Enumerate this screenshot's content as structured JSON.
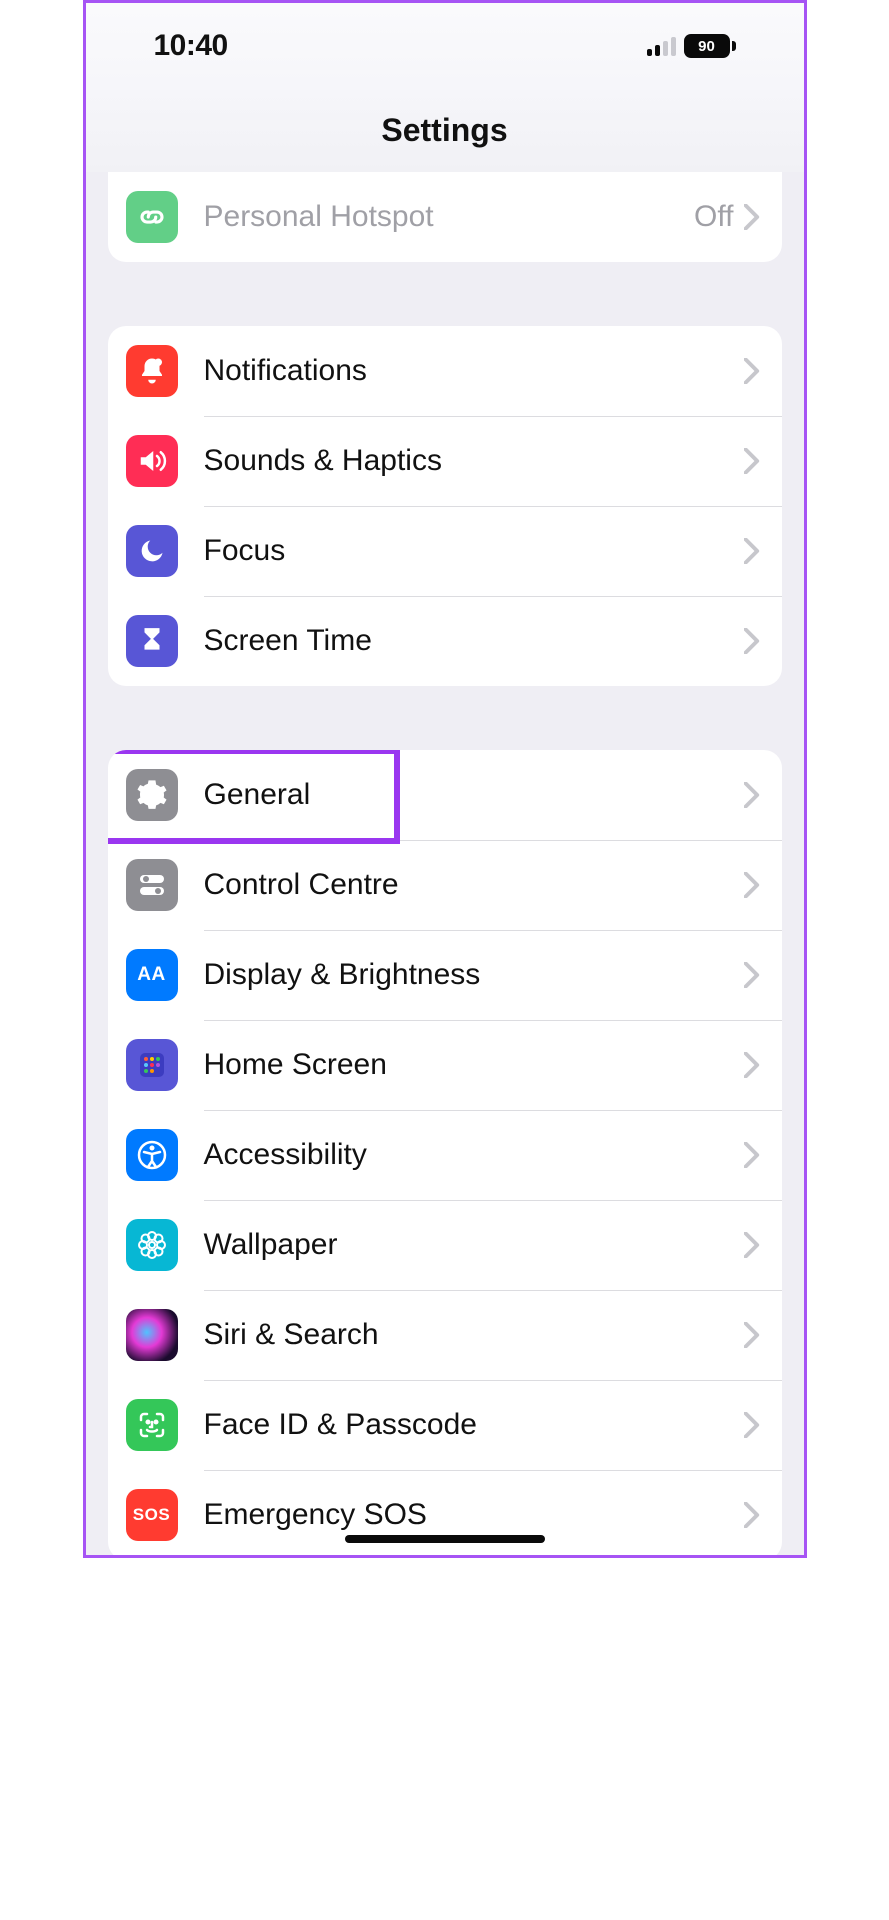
{
  "status": {
    "time": "10:40",
    "battery_pct": "90",
    "signal_active_bars": 2,
    "signal_total_bars": 4
  },
  "nav": {
    "title": "Settings"
  },
  "group0": {
    "items": [
      {
        "label": "Personal Hotspot",
        "detail": "Off",
        "icon_name": "link-icon",
        "icon_bg": "bg-green-hotspot",
        "disabled": true
      }
    ]
  },
  "group1": {
    "items": [
      {
        "label": "Notifications",
        "icon_name": "bell-icon",
        "icon_bg": "bg-red"
      },
      {
        "label": "Sounds & Haptics",
        "icon_name": "speaker-icon",
        "icon_bg": "bg-pink"
      },
      {
        "label": "Focus",
        "icon_name": "moon-icon",
        "icon_bg": "bg-indigo"
      },
      {
        "label": "Screen Time",
        "icon_name": "hourglass-icon",
        "icon_bg": "bg-indigo"
      }
    ]
  },
  "group2": {
    "items": [
      {
        "label": "General",
        "icon_name": "gear-icon",
        "icon_bg": "bg-gray",
        "highlighted": true
      },
      {
        "label": "Control Centre",
        "icon_name": "toggles-icon",
        "icon_bg": "bg-gray"
      },
      {
        "label": "Display & Brightness",
        "icon_name": "text-size-icon",
        "icon_bg": "bg-blue",
        "icon_text": "AA"
      },
      {
        "label": "Home Screen",
        "icon_name": "apps-grid-icon",
        "icon_bg": "bg-indigo"
      },
      {
        "label": "Accessibility",
        "icon_name": "accessibility-icon",
        "icon_bg": "bg-blue"
      },
      {
        "label": "Wallpaper",
        "icon_name": "flower-icon",
        "icon_bg": "bg-cyan"
      },
      {
        "label": "Siri & Search",
        "icon_name": "siri-icon",
        "icon_bg": "bg-siri"
      },
      {
        "label": "Face ID & Passcode",
        "icon_name": "face-id-icon",
        "icon_bg": "bg-green-face"
      },
      {
        "label": "Emergency SOS",
        "icon_name": "sos-icon",
        "icon_bg": "bg-sos",
        "icon_text": "SOS"
      }
    ]
  },
  "annotation": {
    "highlight_target": "General"
  }
}
